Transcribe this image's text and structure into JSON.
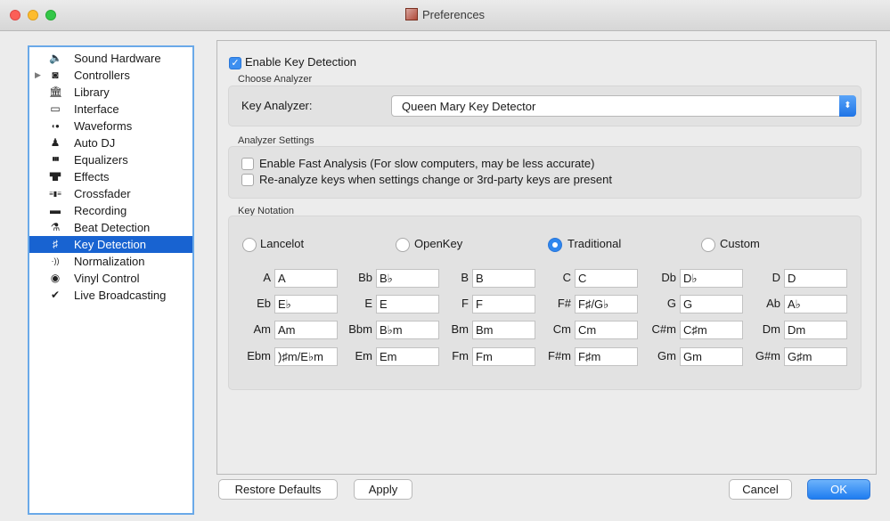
{
  "window": {
    "title": "Preferences"
  },
  "sidebar": {
    "items": [
      {
        "label": "Sound Hardware",
        "icon": "speaker-icon",
        "glyph": "🔈"
      },
      {
        "label": "Controllers",
        "icon": "controller-icon",
        "glyph": "◙"
      },
      {
        "label": "Library",
        "icon": "library-icon",
        "glyph": "🏛"
      },
      {
        "label": "Interface",
        "icon": "monitor-icon",
        "glyph": "▭"
      },
      {
        "label": "Waveforms",
        "icon": "waveforms-icon",
        "glyph": "◖●"
      },
      {
        "label": "Auto DJ",
        "icon": "auto-dj-icon",
        "glyph": "♟"
      },
      {
        "label": "Equalizers",
        "icon": "equalizer-icon",
        "glyph": "▮▮▮"
      },
      {
        "label": "Effects",
        "icon": "effects-icon",
        "glyph": "▜▛"
      },
      {
        "label": "Crossfader",
        "icon": "crossfader-icon",
        "glyph": "≡▮≡"
      },
      {
        "label": "Recording",
        "icon": "recording-icon",
        "glyph": "▬"
      },
      {
        "label": "Beat Detection",
        "icon": "beat-detection-icon",
        "glyph": "⚗"
      },
      {
        "label": "Key Detection",
        "icon": "key-detection-icon",
        "glyph": "♯"
      },
      {
        "label": "Normalization",
        "icon": "normalization-icon",
        "glyph": "·))"
      },
      {
        "label": "Vinyl Control",
        "icon": "vinyl-icon",
        "glyph": "◉"
      },
      {
        "label": "Live Broadcasting",
        "icon": "broadcast-icon",
        "glyph": "✔"
      }
    ],
    "expandable_arrow": "▶",
    "selected": "Key Detection"
  },
  "enable_key_detection": {
    "label": "Enable Key Detection",
    "checked": true,
    "check_glyph": "✓"
  },
  "choose_analyzer": {
    "heading": "Choose Analyzer",
    "field_label": "Key Analyzer:",
    "value": "Queen Mary Key Detector",
    "stepper_glyph": "⬍"
  },
  "analyzer_settings": {
    "heading": "Analyzer Settings",
    "fast_analysis": {
      "label": "Enable Fast Analysis (For slow computers, may be less accurate)",
      "checked": false
    },
    "reanalyze": {
      "label": "Re-analyze keys when settings change or 3rd-party keys are present",
      "checked": false
    }
  },
  "key_notation": {
    "heading": "Key Notation",
    "options": {
      "lancelot": "Lancelot",
      "openkey": "OpenKey",
      "traditional": "Traditional",
      "custom": "Custom"
    },
    "selected": "Traditional",
    "rows": [
      [
        [
          "A",
          "A"
        ],
        [
          "Bb",
          "B♭"
        ],
        [
          "B",
          "B"
        ],
        [
          "C",
          "C"
        ],
        [
          "Db",
          "D♭"
        ],
        [
          "D",
          "D"
        ]
      ],
      [
        [
          "Eb",
          "E♭"
        ],
        [
          "E",
          "E"
        ],
        [
          "F",
          "F"
        ],
        [
          "F#",
          "F♯/G♭"
        ],
        [
          "G",
          "G"
        ],
        [
          "Ab",
          "A♭"
        ]
      ],
      [
        [
          "Am",
          "Am"
        ],
        [
          "Bbm",
          "B♭m"
        ],
        [
          "Bm",
          "Bm"
        ],
        [
          "Cm",
          "Cm"
        ],
        [
          "C#m",
          "C♯m"
        ],
        [
          "Dm",
          "Dm"
        ]
      ],
      [
        [
          "Ebm",
          ")♯m/E♭m"
        ],
        [
          "Em",
          "Em"
        ],
        [
          "Fm",
          "Fm"
        ],
        [
          "F#m",
          "F♯m"
        ],
        [
          "Gm",
          "Gm"
        ],
        [
          "G#m",
          "G♯m"
        ]
      ]
    ]
  },
  "buttons": {
    "restore_defaults": "Restore Defaults",
    "apply": "Apply",
    "cancel": "Cancel",
    "ok": "OK"
  }
}
